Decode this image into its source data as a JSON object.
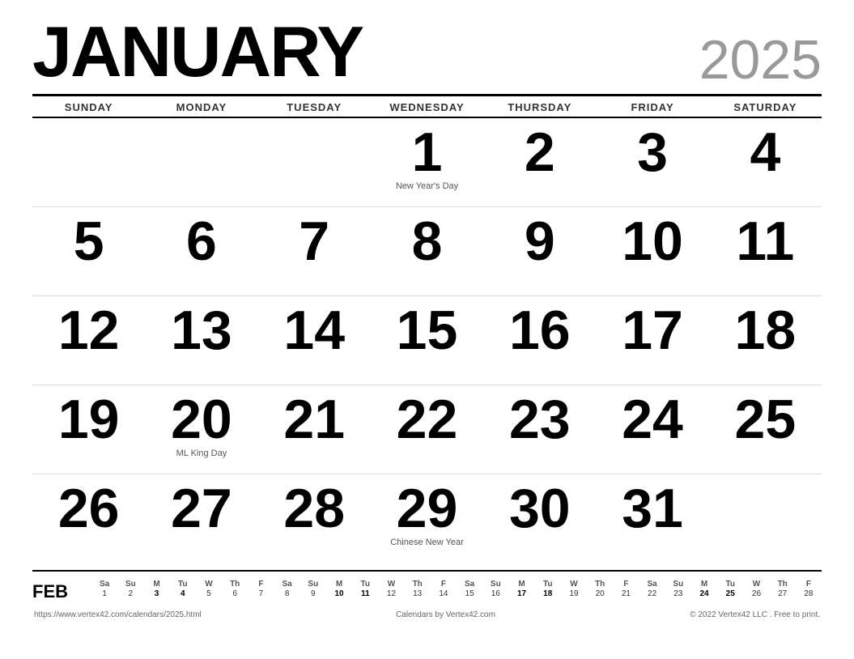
{
  "header": {
    "month": "JANUARY",
    "year": "2025"
  },
  "day_headers": [
    "SUNDAY",
    "MONDAY",
    "TUESDAY",
    "WEDNESDAY",
    "THURSDAY",
    "FRIDAY",
    "SATURDAY"
  ],
  "weeks": [
    [
      {
        "day": "",
        "empty": true
      },
      {
        "day": "",
        "empty": true
      },
      {
        "day": "",
        "empty": true
      },
      {
        "day": "1",
        "holiday": "New Year's Day"
      },
      {
        "day": "2",
        "holiday": ""
      },
      {
        "day": "3",
        "holiday": ""
      },
      {
        "day": "4",
        "holiday": ""
      }
    ],
    [
      {
        "day": "5",
        "holiday": ""
      },
      {
        "day": "6",
        "holiday": ""
      },
      {
        "day": "7",
        "holiday": ""
      },
      {
        "day": "8",
        "holiday": ""
      },
      {
        "day": "9",
        "holiday": ""
      },
      {
        "day": "10",
        "holiday": ""
      },
      {
        "day": "11",
        "holiday": ""
      }
    ],
    [
      {
        "day": "12",
        "holiday": ""
      },
      {
        "day": "13",
        "holiday": ""
      },
      {
        "day": "14",
        "holiday": ""
      },
      {
        "day": "15",
        "holiday": ""
      },
      {
        "day": "16",
        "holiday": ""
      },
      {
        "day": "17",
        "holiday": ""
      },
      {
        "day": "18",
        "holiday": ""
      }
    ],
    [
      {
        "day": "19",
        "holiday": ""
      },
      {
        "day": "20",
        "holiday": "ML King Day"
      },
      {
        "day": "21",
        "holiday": ""
      },
      {
        "day": "22",
        "holiday": ""
      },
      {
        "day": "23",
        "holiday": ""
      },
      {
        "day": "24",
        "holiday": ""
      },
      {
        "day": "25",
        "holiday": ""
      }
    ],
    [
      {
        "day": "26",
        "holiday": ""
      },
      {
        "day": "27",
        "holiday": ""
      },
      {
        "day": "28",
        "holiday": ""
      },
      {
        "day": "29",
        "holiday": "Chinese New Year"
      },
      {
        "day": "30",
        "holiday": ""
      },
      {
        "day": "31",
        "holiday": ""
      },
      {
        "day": "",
        "empty": true
      }
    ]
  ],
  "mini": {
    "label": "FEB",
    "headers": [
      "Sa",
      "Su",
      "M",
      "Tu",
      "W",
      "Th",
      "F",
      "Sa",
      "Su",
      "M",
      "Tu",
      "W",
      "Th",
      "F",
      "Sa",
      "Su",
      "M",
      "Tu",
      "W",
      "Th",
      "F",
      "Sa",
      "Su",
      "M",
      "Tu",
      "W",
      "Th",
      "F"
    ],
    "days": [
      "1",
      "2",
      "3",
      "4",
      "5",
      "6",
      "7",
      "8",
      "9",
      "10",
      "11",
      "12",
      "13",
      "14",
      "15",
      "16",
      "17",
      "18",
      "19",
      "20",
      "21",
      "22",
      "23",
      "24",
      "25",
      "26",
      "27",
      "28"
    ],
    "bold_days": [
      "3",
      "4",
      "10",
      "11",
      "17",
      "18",
      "24",
      "25"
    ]
  },
  "footer": {
    "url": "https://www.vertex42.com/calendars/2025.html",
    "center": "Calendars by Vertex42.com",
    "copyright": "© 2022 Vertex42 LLC . Free to print."
  }
}
